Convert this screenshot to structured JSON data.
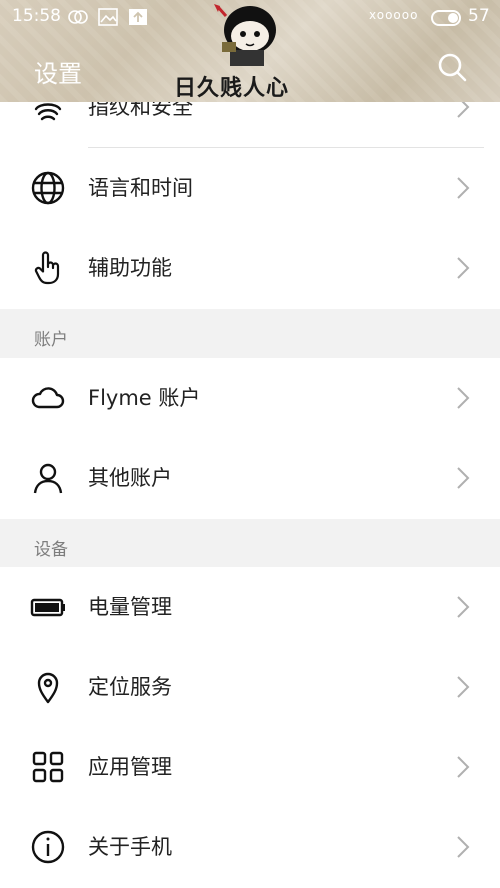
{
  "status_bar": {
    "time": "15:58",
    "signal": "xooooo",
    "battery": "57"
  },
  "header": {
    "title": "设置",
    "watermark": "日久贱人心"
  },
  "rows_top": [
    {
      "label": "指纹和安全",
      "icon": "fingerprint-icon"
    },
    {
      "label": "语言和时间",
      "icon": "globe-icon"
    },
    {
      "label": "辅助功能",
      "icon": "hand-pointer-icon"
    }
  ],
  "sections": [
    {
      "title": "账户",
      "items": [
        {
          "label": "Flyme 账户",
          "icon": "cloud-icon"
        },
        {
          "label": "其他账户",
          "icon": "user-icon"
        }
      ]
    },
    {
      "title": "设备",
      "items": [
        {
          "label": "电量管理",
          "icon": "battery-icon"
        },
        {
          "label": "定位服务",
          "icon": "location-pin-icon"
        },
        {
          "label": "应用管理",
          "icon": "grid-icon"
        },
        {
          "label": "关于手机",
          "icon": "info-icon"
        }
      ]
    }
  ],
  "colors": {
    "text": "#222222",
    "section_bg": "#f2f2f2",
    "section_text": "#7d7d7d",
    "divider": "#e3e3e3",
    "chevron": "#b0b0b0"
  }
}
